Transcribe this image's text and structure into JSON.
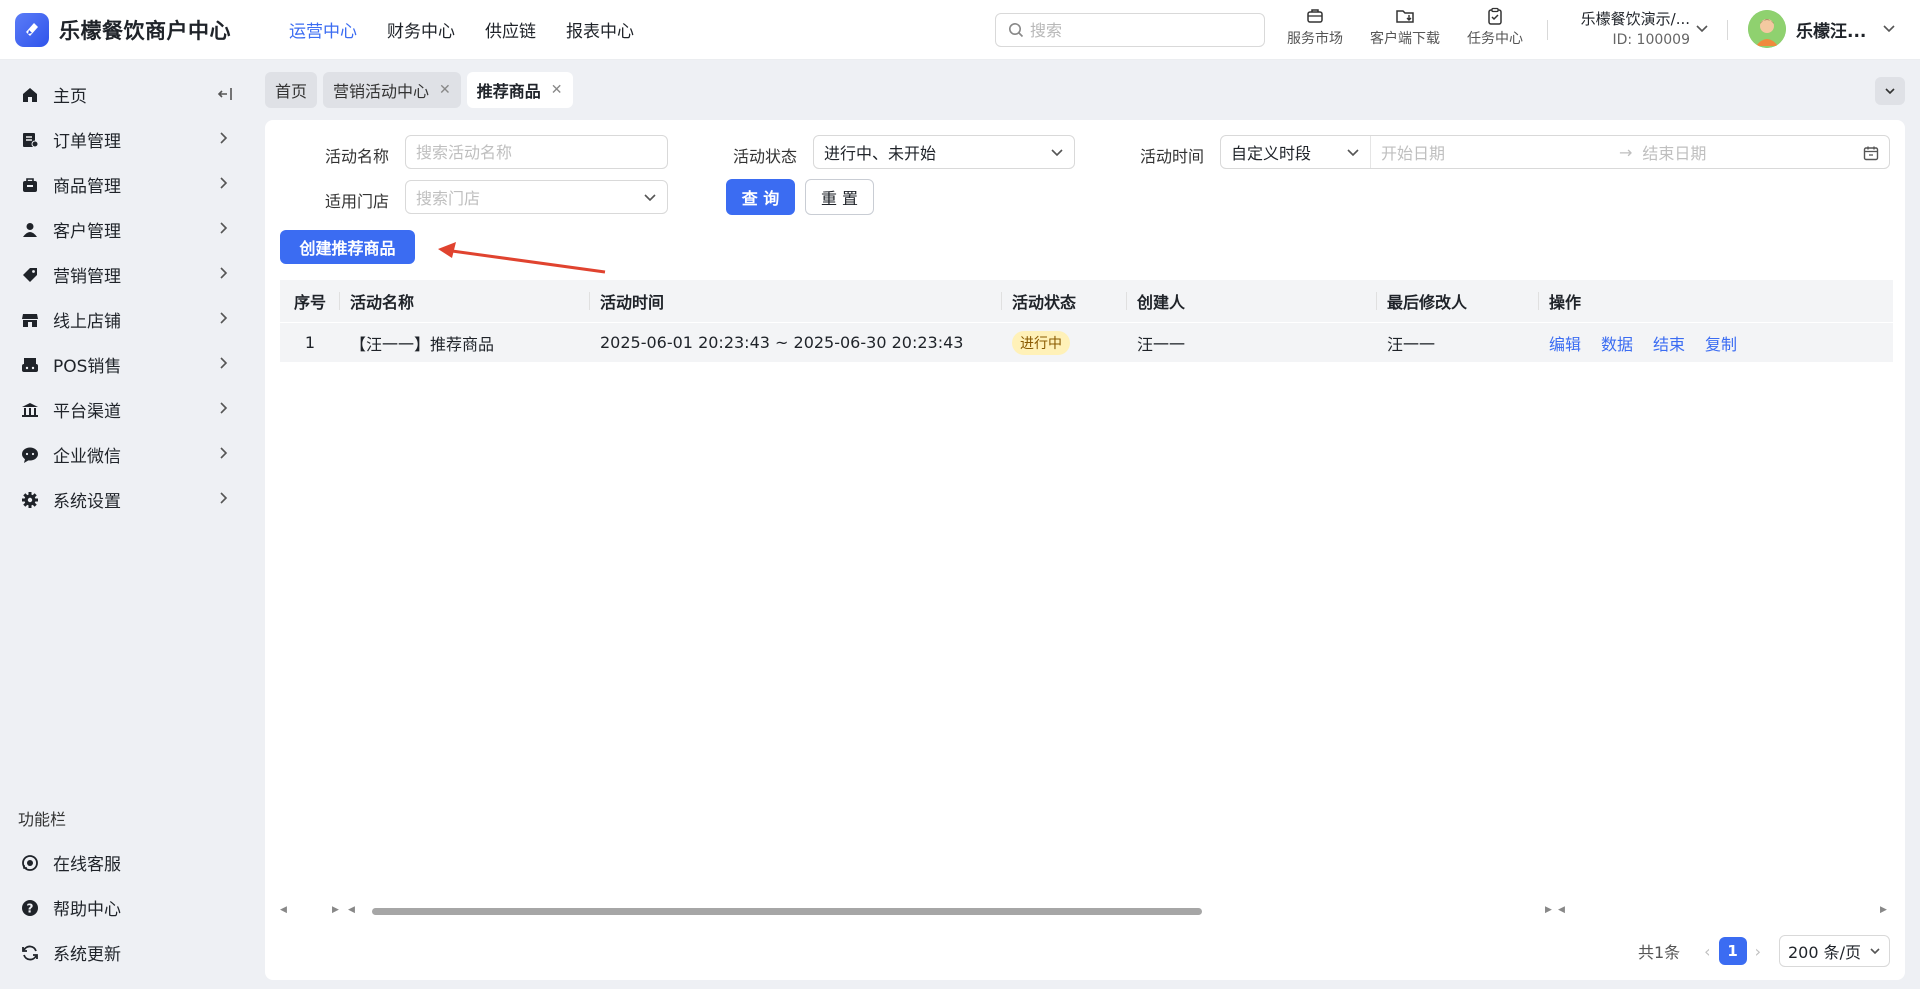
{
  "app": {
    "title": "乐檬餐饮商户中心",
    "logo_mark": "◈"
  },
  "topnav": [
    {
      "label": "运营中心",
      "active": true
    },
    {
      "label": "财务中心"
    },
    {
      "label": "供应链"
    },
    {
      "label": "报表中心"
    }
  ],
  "search": {
    "placeholder": "搜索"
  },
  "tools": [
    {
      "label": "服务市场",
      "icon": "briefcase-icon"
    },
    {
      "label": "客户端下载",
      "icon": "download-folder-icon"
    },
    {
      "label": "任务中心",
      "icon": "clipboard-check-icon"
    }
  ],
  "store": {
    "name": "乐檬餐饮演示/...",
    "id": "ID: 100009"
  },
  "user": {
    "name": "乐檬汪..."
  },
  "sidebar": {
    "items": [
      {
        "label": "主页",
        "icon": "home-icon"
      },
      {
        "label": "订单管理",
        "icon": "order-icon"
      },
      {
        "label": "商品管理",
        "icon": "goods-icon"
      },
      {
        "label": "客户管理",
        "icon": "customer-icon"
      },
      {
        "label": "营销管理",
        "icon": "tag-icon"
      },
      {
        "label": "线上店铺",
        "icon": "shop-icon"
      },
      {
        "label": "POS销售",
        "icon": "pos-icon"
      },
      {
        "label": "平台渠道",
        "icon": "bank-icon"
      },
      {
        "label": "企业微信",
        "icon": "wechat-icon"
      },
      {
        "label": "系统设置",
        "icon": "gear-icon"
      }
    ],
    "func_title": "功能栏",
    "func_items": [
      {
        "label": "在线客服",
        "icon": "headset-icon"
      },
      {
        "label": "帮助中心",
        "icon": "help-icon"
      },
      {
        "label": "系统更新",
        "icon": "refresh-icon"
      }
    ]
  },
  "tabs": [
    {
      "label": "首页",
      "closable": false
    },
    {
      "label": "营销活动中心",
      "closable": true
    },
    {
      "label": "推荐商品",
      "closable": true,
      "active": true
    }
  ],
  "filters": {
    "name_label": "活动名称",
    "name_placeholder": "搜索活动名称",
    "status_label": "活动状态",
    "status_value": "进行中、未开始",
    "time_label": "活动时间",
    "time_mode": "自定义时段",
    "start_placeholder": "开始日期",
    "end_placeholder": "结束日期",
    "range_sep": "→",
    "store_label": "适用门店",
    "store_placeholder": "搜索门店",
    "query_button": "查 询",
    "reset_button": "重 置"
  },
  "create_button": "创建推荐商品",
  "table": {
    "headers": [
      "序号",
      "活动名称",
      "活动时间",
      "活动状态",
      "创建人",
      "最后修改人",
      "操作"
    ],
    "rows": [
      {
        "index": "1",
        "name": "【汪一一】推荐商品",
        "time": "2025-06-01 20:23:43 ~ 2025-06-30 20:23:43",
        "status": "进行中",
        "creator": "汪一一",
        "modifier": "汪一一",
        "ops": [
          "编辑",
          "数据",
          "结束",
          "复制"
        ]
      }
    ]
  },
  "pagination": {
    "total": "共1条",
    "current": "1",
    "page_size": "200 条/页"
  },
  "colors": {
    "accent": "#3b6cf2",
    "status_bg": "#fff1b8",
    "annotation_arrow": "#e0432f"
  }
}
